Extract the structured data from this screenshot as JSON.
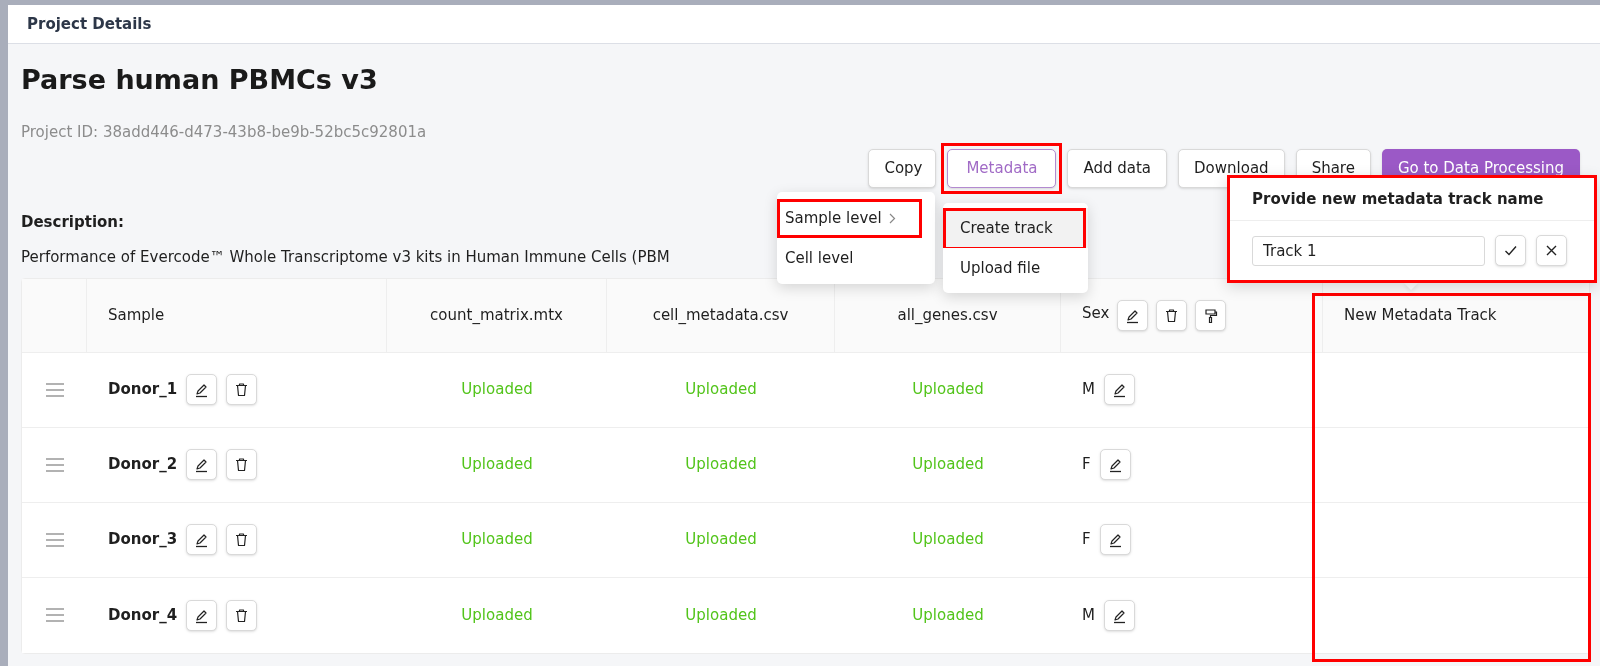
{
  "window": {
    "title": "Project Details"
  },
  "project": {
    "name": "Parse human PBMCs v3",
    "id_line": "Project ID: 38add446-d473-43b8-be9b-52bc5c92801a"
  },
  "toolbar": [
    {
      "label": "Copy",
      "kind": "default",
      "highlighted": false
    },
    {
      "label": "Metadata",
      "kind": "outline",
      "highlighted": true
    },
    {
      "label": "Add data",
      "kind": "default",
      "highlighted": false
    },
    {
      "label": "Download",
      "kind": "default",
      "highlighted": false
    },
    {
      "label": "Share",
      "kind": "default",
      "highlighted": false
    },
    {
      "label": "Go to Data Processing",
      "kind": "primary",
      "highlighted": false
    }
  ],
  "description": {
    "label": "Description:",
    "text": "Performance of Evercode™ Whole Transcriptome v3 kits in Human Immune Cells (PBM"
  },
  "metadata_menu": {
    "items": [
      {
        "label": "Sample level",
        "has_submenu": true,
        "highlighted": true
      },
      {
        "label": "Cell level",
        "has_submenu": false,
        "highlighted": false
      }
    ]
  },
  "submenu": {
    "items": [
      {
        "label": "Create track",
        "hovered": true,
        "highlighted": true
      },
      {
        "label": "Upload file",
        "hovered": false,
        "highlighted": false
      }
    ]
  },
  "track_popover": {
    "title": "Provide new metadata track name",
    "value": "Track 1",
    "highlighted": true
  },
  "table": {
    "columns": [
      {
        "label": "Sample",
        "kind": "sample",
        "highlighted": false
      },
      {
        "label": "count_matrix.mtx",
        "kind": "file",
        "highlighted": false
      },
      {
        "label": "cell_metadata.csv",
        "kind": "file",
        "highlighted": false
      },
      {
        "label": "all_genes.csv",
        "kind": "file",
        "highlighted": false
      },
      {
        "label": "Sex",
        "kind": "metadata",
        "highlighted": false
      },
      {
        "label": "New Metadata Track",
        "kind": "new",
        "highlighted": true
      }
    ],
    "rows": [
      {
        "sample": "Donor_1",
        "files": [
          "Uploaded",
          "Uploaded",
          "Uploaded"
        ],
        "sex": "M"
      },
      {
        "sample": "Donor_2",
        "files": [
          "Uploaded",
          "Uploaded",
          "Uploaded"
        ],
        "sex": "F"
      },
      {
        "sample": "Donor_3",
        "files": [
          "Uploaded",
          "Uploaded",
          "Uploaded"
        ],
        "sex": "F"
      },
      {
        "sample": "Donor_4",
        "files": [
          "Uploaded",
          "Uploaded",
          "Uploaded"
        ],
        "sex": "M"
      }
    ]
  }
}
